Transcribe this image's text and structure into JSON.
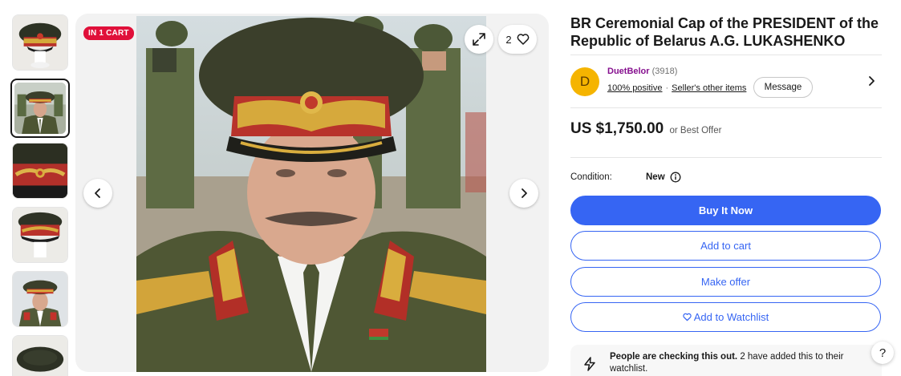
{
  "gallery": {
    "badge": "IN 1 CART",
    "watch_count": "2",
    "thumbnails": [
      {
        "name": "cap-front"
      },
      {
        "name": "president-portrait"
      },
      {
        "name": "cap-embroidery-closeup"
      },
      {
        "name": "cap-side"
      },
      {
        "name": "president-portrait-2"
      },
      {
        "name": "cap-top"
      }
    ]
  },
  "listing": {
    "title": "BR Ceremonial Cap of the PRESIDENT of the Republic of Belarus A.G. LUKASHENKO"
  },
  "seller": {
    "initial": "D",
    "name": "DuetBelor",
    "feedback_count": "(3918)",
    "positive": "100% positive",
    "other_items": "Seller's other items",
    "message_label": "Message"
  },
  "price": {
    "amount": "US $1,750.00",
    "note": "or Best Offer"
  },
  "condition": {
    "label": "Condition:",
    "value": "New"
  },
  "actions": {
    "buy_now": "Buy It Now",
    "add_to_cart": "Add to cart",
    "make_offer": "Make offer",
    "watchlist": "Add to Watchlist"
  },
  "notice": {
    "bold": "People are checking this out.",
    "rest": " 2 have added this to their watchlist."
  },
  "help": "?",
  "colors": {
    "primary_blue": "#3665f3",
    "badge_red": "#e0103a",
    "seller_purple": "#86108f",
    "avatar_yellow": "#f5b400"
  }
}
